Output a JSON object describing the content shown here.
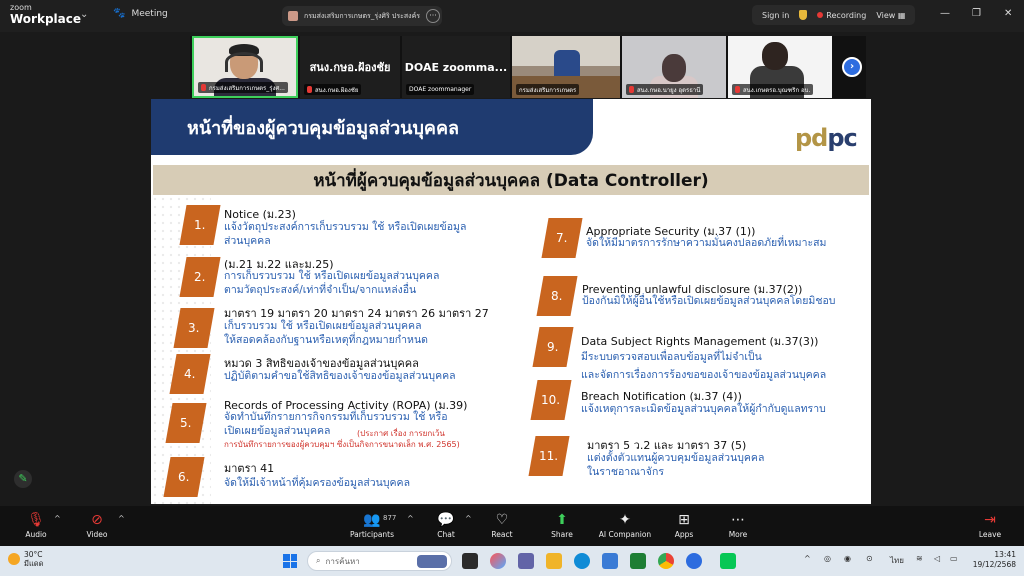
{
  "titlebar": {
    "brand_small": "zoom",
    "brand_big": "Workplace",
    "meeting_label": "Meeting",
    "share_title": "กรมส่งเสริมการเกษตร_รุ่งศิริ ประสงค์ร",
    "sign_in": "Sign in",
    "recording": "Recording",
    "view": "View"
  },
  "video_strip": {
    "tiles": [
      {
        "caption": "กรมส่งเสริมการเกษตร_รุ่งศ..."
      },
      {
        "big": "สนง.กษอ.ฝ้องชัย",
        "caption": "สนง.กษอ.ฝ้องชัย"
      },
      {
        "big": "DOAE zoomma...",
        "caption": "DOAE zoommanager"
      },
      {
        "caption": "กรมส่งเสริมการเกษตร"
      },
      {
        "caption": "สนง.กษอ.นายูง อุดรธานี"
      },
      {
        "caption": "สนง.เกษตรอ.บุณฑริก อบ."
      }
    ]
  },
  "slide": {
    "header": "หน้าที่ของผู้ควบคุมข้อมูลส่วนบุคคล",
    "logo_pd": "pd",
    "logo_pc": "pc",
    "banner": "หน้าที่ผู้ควบคุมข้อมูลส่วนบุคคล (Data Controller)",
    "items": [
      {
        "num": "1.",
        "title": "Notice (ม.23)",
        "desc1": "แจ้งวัตถุประสงค์การเก็บรวบรวม ใช้ หรือเปิดเผยข้อมูล",
        "desc2": "ส่วนบุคคล"
      },
      {
        "num": "2.",
        "title": "(ม.21 ม.22 และม.25)",
        "desc1": "การเก็บรวบรวม ใช้ หรือเปิดเผยข้อมูลส่วนบุคคล",
        "desc2": "ตามวัตถุประสงค์/เท่าที่จำเป็น/จากแหล่งอื่น"
      },
      {
        "num": "3.",
        "title": "มาตรา 19 มาตรา 20 มาตรา 24 มาตรา 26 มาตรา 27",
        "desc1": "เก็บรวบรวม ใช้ หรือเปิดเผยข้อมูลส่วนบุคคล",
        "desc2": "ให้สอดคล้องกับฐานหรือเหตุที่กฎหมายกำหนด"
      },
      {
        "num": "4.",
        "title": "หมวด 3 สิทธิของเจ้าของข้อมูลส่วนบุคคล",
        "desc1": "ปฏิบัติตามคำขอใช้สิทธิของเจ้าของข้อมูลส่วนบุคคล",
        "desc2": ""
      },
      {
        "num": "5.",
        "title": "Records of Processing Activity (ROPA) (ม.39)",
        "desc1": "จัดทำบันทึกรายการกิจกรรมที่เก็บรวบรวม ใช้ หรือ",
        "desc2": "เปิดเผยข้อมูลส่วนบุคคล",
        "note1": "(ประกาศ เรื่อง การยกเว้น",
        "note2": "การบันทึกรายการของผู้ควบคุมฯ ซึ่งเป็นกิจการขนาดเล็ก พ.ศ. 2565)"
      },
      {
        "num": "6.",
        "title": "มาตรา 41",
        "desc1": "จัดให้มีเจ้าหน้าที่คุ้มครองข้อมูลส่วนบุคคล",
        "desc2": ""
      },
      {
        "num": "7.",
        "title": "Appropriate Security (ม.37 (1))",
        "desc1": "จัดให้มีมาตรการรักษาความมั่นคงปลอดภัยที่เหมาะสม",
        "desc2": ""
      },
      {
        "num": "8.",
        "title": "Preventing unlawful disclosure (ม.37(2))",
        "desc1": "ป้องกันมิให้ผู้อื่นใช้หรือเปิดเผยข้อมูลส่วนบุคคลโดยมิชอบ",
        "desc2": ""
      },
      {
        "num": "9.",
        "title": "Data Subject Rights Management (ม.37(3))",
        "desc1": "มีระบบตรวจสอบเพื่อลบข้อมูลที่ไม่จำเป็น",
        "desc2": "และจัดการเรื่องการร้องขอของเจ้าของข้อมูลส่วนบุคคล"
      },
      {
        "num": "10.",
        "title": "Breach Notification (ม.37 (4))",
        "desc1": "แจ้งเหตุการละเมิดข้อมูลส่วนบุคคลให้ผู้กำกับดูแลทราบ",
        "desc2": ""
      },
      {
        "num": "11.",
        "title": "มาตรา 5 ว.2 และ มาตรา 37 (5)",
        "desc1": "แต่งตั้งตัวแทนผู้ควบคุมข้อมูลส่วนบุคคล",
        "desc2": "ในราชอาณาจักร"
      }
    ]
  },
  "toolbar": {
    "audio": "Audio",
    "video": "Video",
    "participants": "Participants",
    "participants_count": "877",
    "chat": "Chat",
    "react": "React",
    "share": "Share",
    "ai_companion": "AI Companion",
    "apps": "Apps",
    "more": "More",
    "leave": "Leave"
  },
  "taskbar": {
    "temp": "30°C",
    "weather_desc": "มีแดด",
    "search_placeholder": "การค้นหา",
    "lang": "ไทย",
    "time": "13:41",
    "date": "19/12/2568"
  },
  "colors": {
    "slide_header": "#1f3b70",
    "banner": "#d7ccb6",
    "number_box": "#c9651f",
    "desc_text": "#2a5fb0",
    "active_speaker": "#3ecf5b"
  }
}
